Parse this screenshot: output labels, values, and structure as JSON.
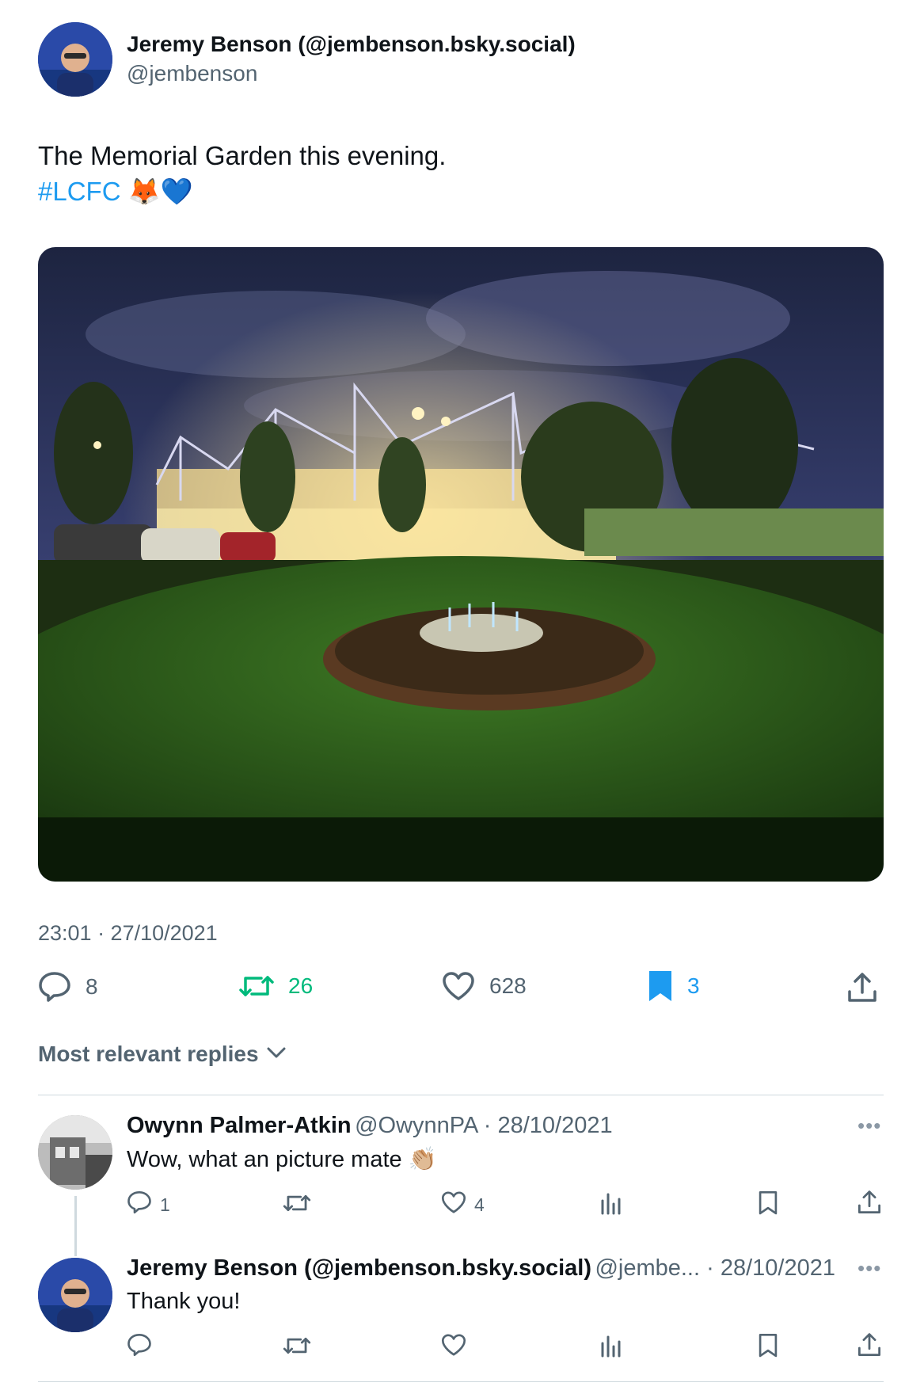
{
  "tweet": {
    "author_name": "Jeremy Benson (@jembenson.bsky.social)",
    "author_handle": "@jembenson",
    "text_line1": "The Memorial Garden this evening.",
    "hashtag": "#LCFC",
    "emoji": "🦊💙",
    "timestamp": "23:01 · 27/10/2021",
    "stats": {
      "replies": "8",
      "reposts": "26",
      "likes": "628",
      "bookmarks": "3"
    }
  },
  "replies_header": {
    "label": "Most relevant replies"
  },
  "replies": [
    {
      "name": "Owynn Palmer-Atkin",
      "meta": "@OwynnPA · 28/10/2021",
      "text": "Wow, what an picture mate",
      "emoji": "👏🏼",
      "reply_count": "1",
      "like_count": "4"
    },
    {
      "name": "Jeremy Benson (@jembenson.bsky.social)",
      "meta": "@jembe... · 28/10/2021",
      "text": "Thank you!",
      "reply_count": "",
      "like_count": ""
    }
  ],
  "icons": {
    "more": "more-dots-icon"
  },
  "colors": {
    "accent": "#1d9bf0",
    "repost": "#00ba7c",
    "muted": "#536471"
  }
}
